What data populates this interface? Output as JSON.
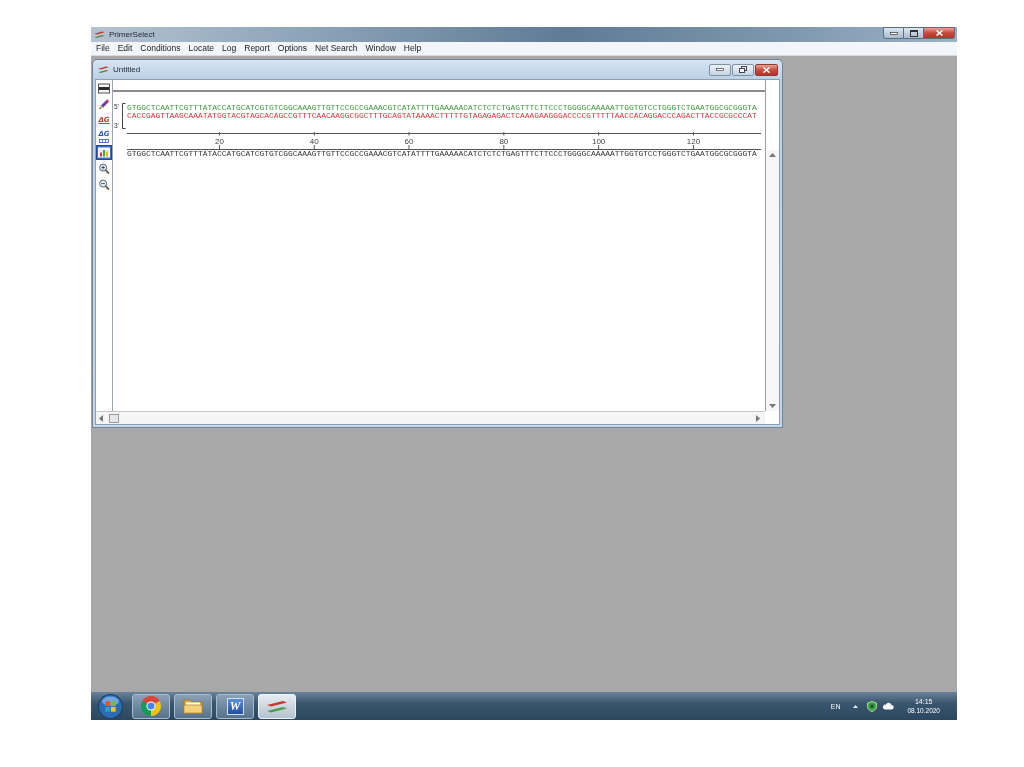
{
  "window": {
    "title": "PrimerSelect"
  },
  "menu": [
    "File",
    "Edit",
    "Conditions",
    "Locate",
    "Log",
    "Report",
    "Options",
    "Net Search",
    "Window",
    "Help"
  ],
  "document": {
    "title": "Untitled",
    "toolbar": [
      {
        "kind": "window",
        "selected": false
      },
      {
        "kind": "pen",
        "selected": false
      },
      {
        "kind": "delta-g",
        "label": "ΔG",
        "selected": false
      },
      {
        "kind": "delta-g-table",
        "label": "ΔG",
        "selected": false
      },
      {
        "kind": "chart",
        "selected": true
      },
      {
        "kind": "zoom-in",
        "selected": false
      },
      {
        "kind": "zoom-out",
        "selected": false
      }
    ],
    "strands": [
      {
        "end": "5'",
        "color": "#3d9a3d",
        "sequence": "GTGGCTCAATTCGTTTATACCATGCATCGTGTCGGCAAAGTTGTTCCGCCGAAACGTCATATTTTGAAAAACATCTCTCTGAGTTTCTTCCCTGGGGCAAAAATTGGTGTCCTGGGTCTGAATGGCGCGGGTA"
      },
      {
        "end": "3'",
        "color": "#cc3a3a",
        "sequence": "CACCGAGTTAAGCAAATATGGTACGTAGCACAGCCGTTTCAACAAGGCGGCTTTGCAGTATAAAACTTTTTGTAGAGAGACTCAAAGAAGGGACCCCGTTTTTAACCACAGGACCCAGACTTACCGCGCCCAT"
      }
    ],
    "ruler": [
      "20",
      "40",
      "60",
      "80",
      "100",
      "120"
    ],
    "sequence": "GTGGCTCAATTCGTTTATACCATGCATCGTGTCGGCAAAGTTGTTCCGCCGAAACGTCATATTTTGAAAAACATCTCTCTGAGTTTCTTCCCTGGGGCAAAAATTGGTGTCCTGGGTCTGAATGGCGCGGGTA"
  },
  "taskbar": {
    "apps": [
      {
        "kind": "start",
        "selected": false
      },
      {
        "kind": "browser",
        "selected": false
      },
      {
        "kind": "folder",
        "selected": false
      },
      {
        "kind": "word",
        "label": "W",
        "selected": false
      },
      {
        "kind": "primer",
        "selected": true
      }
    ],
    "language": "EN",
    "time": "14:15",
    "date": "08.10.2020"
  }
}
